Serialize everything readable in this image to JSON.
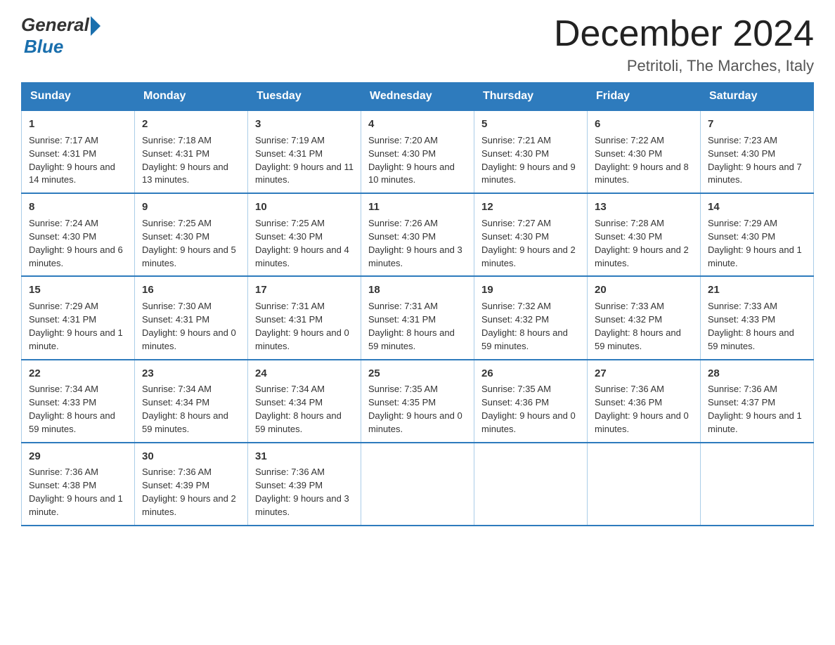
{
  "header": {
    "logo_general": "General",
    "logo_blue": "Blue",
    "month_title": "December 2024",
    "location": "Petritoli, The Marches, Italy"
  },
  "days_of_week": [
    "Sunday",
    "Monday",
    "Tuesday",
    "Wednesday",
    "Thursday",
    "Friday",
    "Saturday"
  ],
  "weeks": [
    [
      {
        "day": "1",
        "sunrise": "7:17 AM",
        "sunset": "4:31 PM",
        "daylight": "9 hours and 14 minutes."
      },
      {
        "day": "2",
        "sunrise": "7:18 AM",
        "sunset": "4:31 PM",
        "daylight": "9 hours and 13 minutes."
      },
      {
        "day": "3",
        "sunrise": "7:19 AM",
        "sunset": "4:31 PM",
        "daylight": "9 hours and 11 minutes."
      },
      {
        "day": "4",
        "sunrise": "7:20 AM",
        "sunset": "4:30 PM",
        "daylight": "9 hours and 10 minutes."
      },
      {
        "day": "5",
        "sunrise": "7:21 AM",
        "sunset": "4:30 PM",
        "daylight": "9 hours and 9 minutes."
      },
      {
        "day": "6",
        "sunrise": "7:22 AM",
        "sunset": "4:30 PM",
        "daylight": "9 hours and 8 minutes."
      },
      {
        "day": "7",
        "sunrise": "7:23 AM",
        "sunset": "4:30 PM",
        "daylight": "9 hours and 7 minutes."
      }
    ],
    [
      {
        "day": "8",
        "sunrise": "7:24 AM",
        "sunset": "4:30 PM",
        "daylight": "9 hours and 6 minutes."
      },
      {
        "day": "9",
        "sunrise": "7:25 AM",
        "sunset": "4:30 PM",
        "daylight": "9 hours and 5 minutes."
      },
      {
        "day": "10",
        "sunrise": "7:25 AM",
        "sunset": "4:30 PM",
        "daylight": "9 hours and 4 minutes."
      },
      {
        "day": "11",
        "sunrise": "7:26 AM",
        "sunset": "4:30 PM",
        "daylight": "9 hours and 3 minutes."
      },
      {
        "day": "12",
        "sunrise": "7:27 AM",
        "sunset": "4:30 PM",
        "daylight": "9 hours and 2 minutes."
      },
      {
        "day": "13",
        "sunrise": "7:28 AM",
        "sunset": "4:30 PM",
        "daylight": "9 hours and 2 minutes."
      },
      {
        "day": "14",
        "sunrise": "7:29 AM",
        "sunset": "4:30 PM",
        "daylight": "9 hours and 1 minute."
      }
    ],
    [
      {
        "day": "15",
        "sunrise": "7:29 AM",
        "sunset": "4:31 PM",
        "daylight": "9 hours and 1 minute."
      },
      {
        "day": "16",
        "sunrise": "7:30 AM",
        "sunset": "4:31 PM",
        "daylight": "9 hours and 0 minutes."
      },
      {
        "day": "17",
        "sunrise": "7:31 AM",
        "sunset": "4:31 PM",
        "daylight": "9 hours and 0 minutes."
      },
      {
        "day": "18",
        "sunrise": "7:31 AM",
        "sunset": "4:31 PM",
        "daylight": "8 hours and 59 minutes."
      },
      {
        "day": "19",
        "sunrise": "7:32 AM",
        "sunset": "4:32 PM",
        "daylight": "8 hours and 59 minutes."
      },
      {
        "day": "20",
        "sunrise": "7:33 AM",
        "sunset": "4:32 PM",
        "daylight": "8 hours and 59 minutes."
      },
      {
        "day": "21",
        "sunrise": "7:33 AM",
        "sunset": "4:33 PM",
        "daylight": "8 hours and 59 minutes."
      }
    ],
    [
      {
        "day": "22",
        "sunrise": "7:34 AM",
        "sunset": "4:33 PM",
        "daylight": "8 hours and 59 minutes."
      },
      {
        "day": "23",
        "sunrise": "7:34 AM",
        "sunset": "4:34 PM",
        "daylight": "8 hours and 59 minutes."
      },
      {
        "day": "24",
        "sunrise": "7:34 AM",
        "sunset": "4:34 PM",
        "daylight": "8 hours and 59 minutes."
      },
      {
        "day": "25",
        "sunrise": "7:35 AM",
        "sunset": "4:35 PM",
        "daylight": "9 hours and 0 minutes."
      },
      {
        "day": "26",
        "sunrise": "7:35 AM",
        "sunset": "4:36 PM",
        "daylight": "9 hours and 0 minutes."
      },
      {
        "day": "27",
        "sunrise": "7:36 AM",
        "sunset": "4:36 PM",
        "daylight": "9 hours and 0 minutes."
      },
      {
        "day": "28",
        "sunrise": "7:36 AM",
        "sunset": "4:37 PM",
        "daylight": "9 hours and 1 minute."
      }
    ],
    [
      {
        "day": "29",
        "sunrise": "7:36 AM",
        "sunset": "4:38 PM",
        "daylight": "9 hours and 1 minute."
      },
      {
        "day": "30",
        "sunrise": "7:36 AM",
        "sunset": "4:39 PM",
        "daylight": "9 hours and 2 minutes."
      },
      {
        "day": "31",
        "sunrise": "7:36 AM",
        "sunset": "4:39 PM",
        "daylight": "9 hours and 3 minutes."
      },
      null,
      null,
      null,
      null
    ]
  ],
  "labels": {
    "sunrise": "Sunrise:",
    "sunset": "Sunset:",
    "daylight": "Daylight:"
  }
}
